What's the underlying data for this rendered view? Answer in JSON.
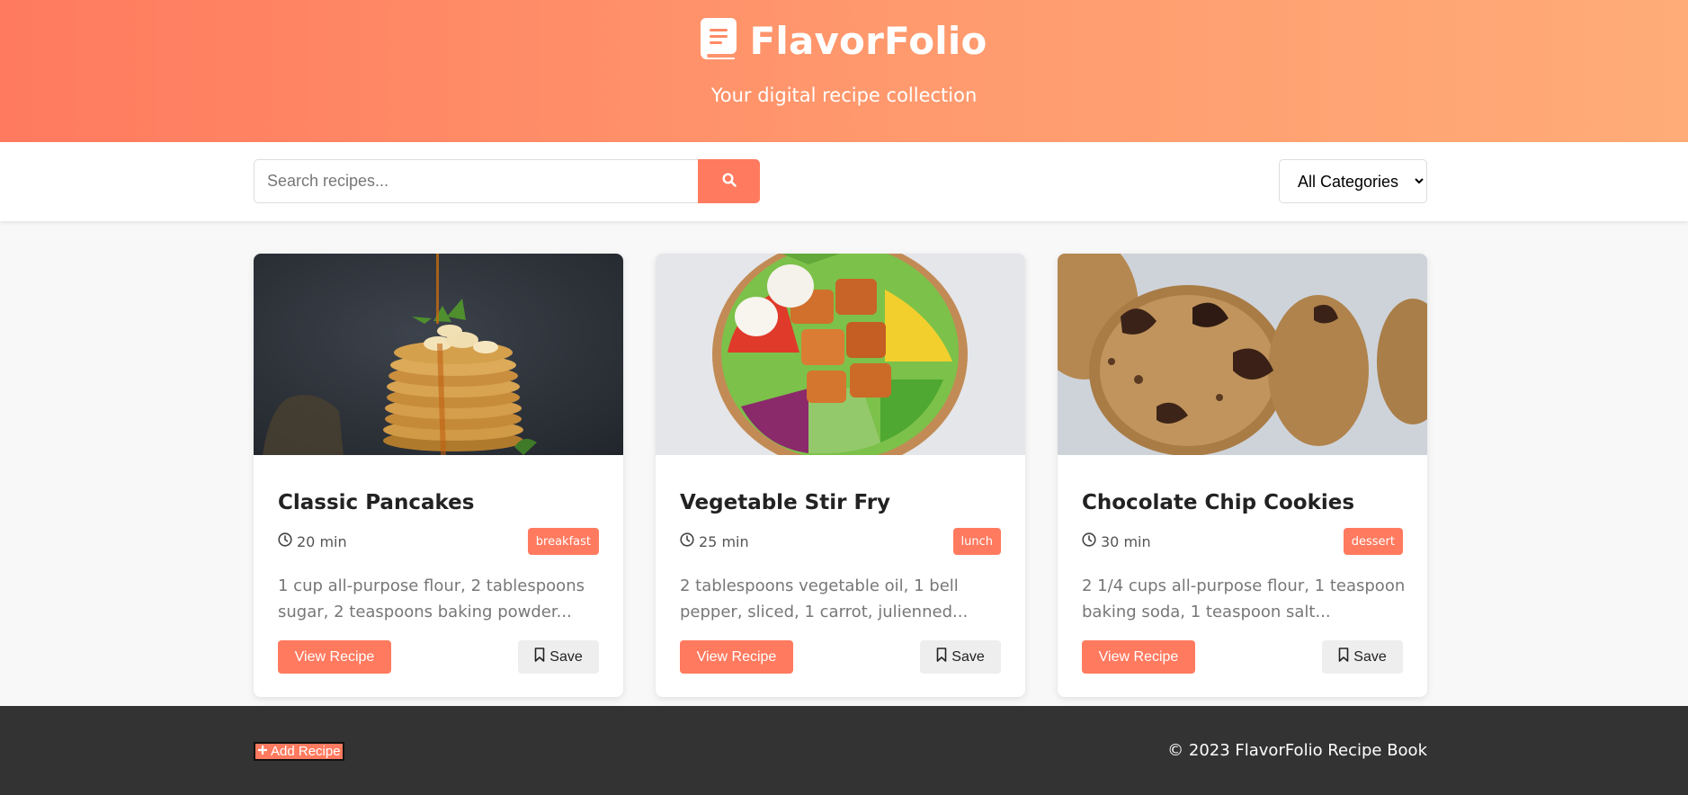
{
  "header": {
    "brand_icon": "recipe-book-icon",
    "title": "FlavorFolio",
    "tagline": "Your digital recipe collection"
  },
  "toolbar": {
    "search_placeholder": "Search recipes...",
    "search_icon": "search-icon",
    "category_selected": "All Categories"
  },
  "recipes": [
    {
      "title": "Classic Pancakes",
      "time": "20 min",
      "category": "breakfast",
      "description": "1 cup all-purpose flour, 2 tablespoons sugar, 2 teaspoons baking powder...",
      "view_label": "View Recipe",
      "save_label": "Save"
    },
    {
      "title": "Vegetable Stir Fry",
      "time": "25 min",
      "category": "lunch",
      "description": "2 tablespoons vegetable oil, 1 bell pepper, sliced, 1 carrot, julienned...",
      "view_label": "View Recipe",
      "save_label": "Save"
    },
    {
      "title": "Chocolate Chip Cookies",
      "time": "30 min",
      "category": "dessert",
      "description": "2 1/4 cups all-purpose flour, 1 teaspoon baking soda, 1 teaspoon salt...",
      "view_label": "View Recipe",
      "save_label": "Save"
    }
  ],
  "footer": {
    "add_recipe_label": "Add Recipe",
    "copyright": "© 2023 FlavorFolio Recipe Book"
  },
  "colors": {
    "accent": "#ff7a5f",
    "header_gradient_end": "#ffac78",
    "footer_bg": "#333333"
  }
}
